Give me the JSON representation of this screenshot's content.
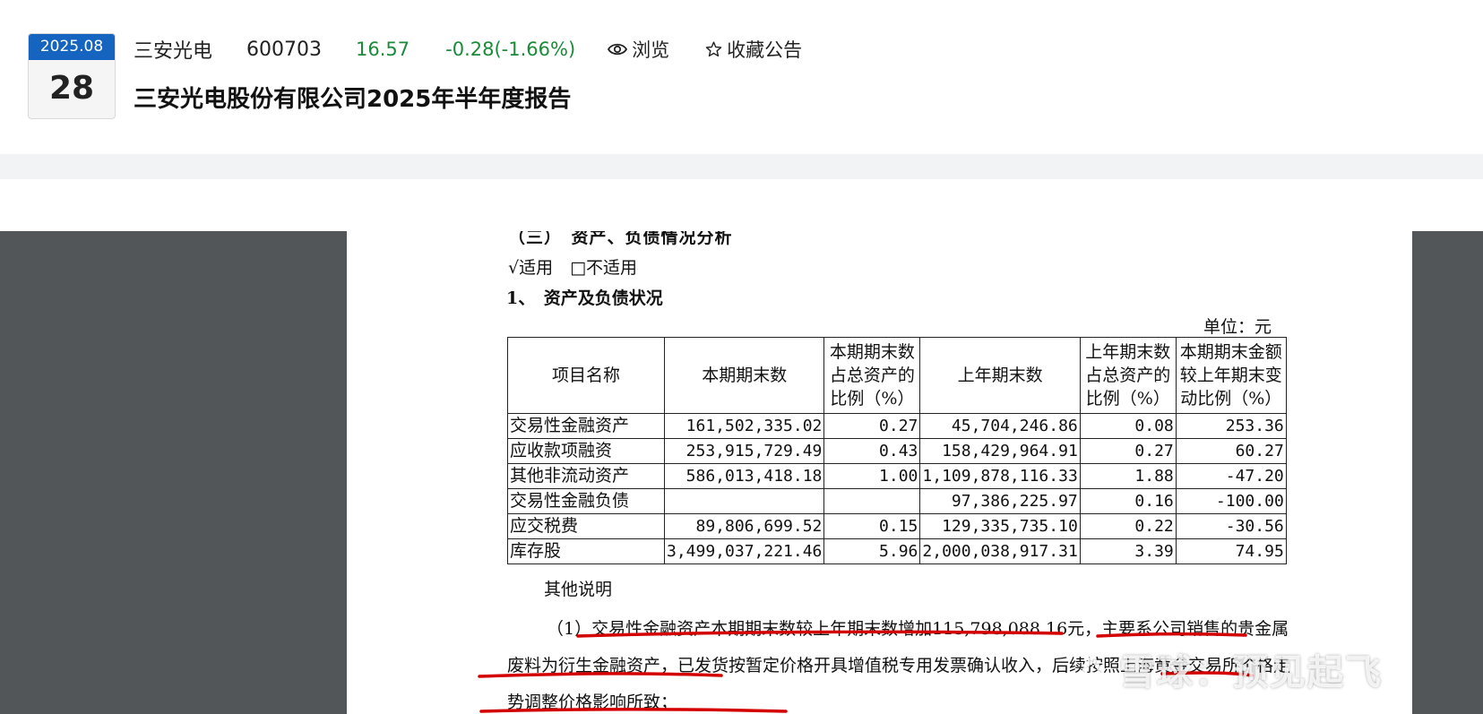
{
  "header": {
    "date_month": "2025.08",
    "date_day": "28",
    "stock_name": "三安光电",
    "stock_code": "600703",
    "price": "16.57",
    "change": "-0.28(-1.66%)",
    "browse_label": "浏览",
    "favorite_label": "收藏公告",
    "report_title": "三安光电股份有限公司2025年半年度报告",
    "up_down_color": "#1b8a3a"
  },
  "document": {
    "section_heading": "（三）　资产、负债情况分析",
    "applicability": "√适用　□不适用",
    "sub_heading": "1、　资产及负债状况",
    "unit": "单位：元",
    "table": {
      "headers": [
        "项目名称",
        "本期期末数",
        "本期期末数占总资产的比例（%）",
        "上年期末数",
        "上年期末数占总资产的比例（%）",
        "本期期末金额较上年期末变动比例（%）"
      ],
      "rows": [
        [
          "交易性金融资产",
          "161,502,335.02",
          "0.27",
          "45,704,246.86",
          "0.08",
          "253.36"
        ],
        [
          "应收款项融资",
          "253,915,729.49",
          "0.43",
          "158,429,964.91",
          "0.27",
          "60.27"
        ],
        [
          "其他非流动资产",
          "586,013,418.18",
          "1.00",
          "1,109,878,116.33",
          "1.88",
          "-47.20"
        ],
        [
          "交易性金融负债",
          "",
          "",
          "97,386,225.97",
          "0.16",
          "-100.00"
        ],
        [
          "应交税费",
          "89,806,699.52",
          "0.15",
          "129,335,735.10",
          "0.22",
          "-30.56"
        ],
        [
          "库存股",
          "3,499,037,221.46",
          "5.96",
          "2,000,038,917.31",
          "3.39",
          "74.95"
        ]
      ]
    },
    "note_title": "其他说明",
    "note_paragraph": "（1）交易性金融资产本期期末数较上年期末数增加115,798,088.16元，主要系公司销售的贵金属废料为衍生金融资产，已发货按暂定价格开具增值税专用发票确认收入，后续按照上海黄金交易所价格走势调整价格影响所致；"
  },
  "watermark": {
    "text": "雪球：预见起飞"
  },
  "annotation_color": "#d40000"
}
